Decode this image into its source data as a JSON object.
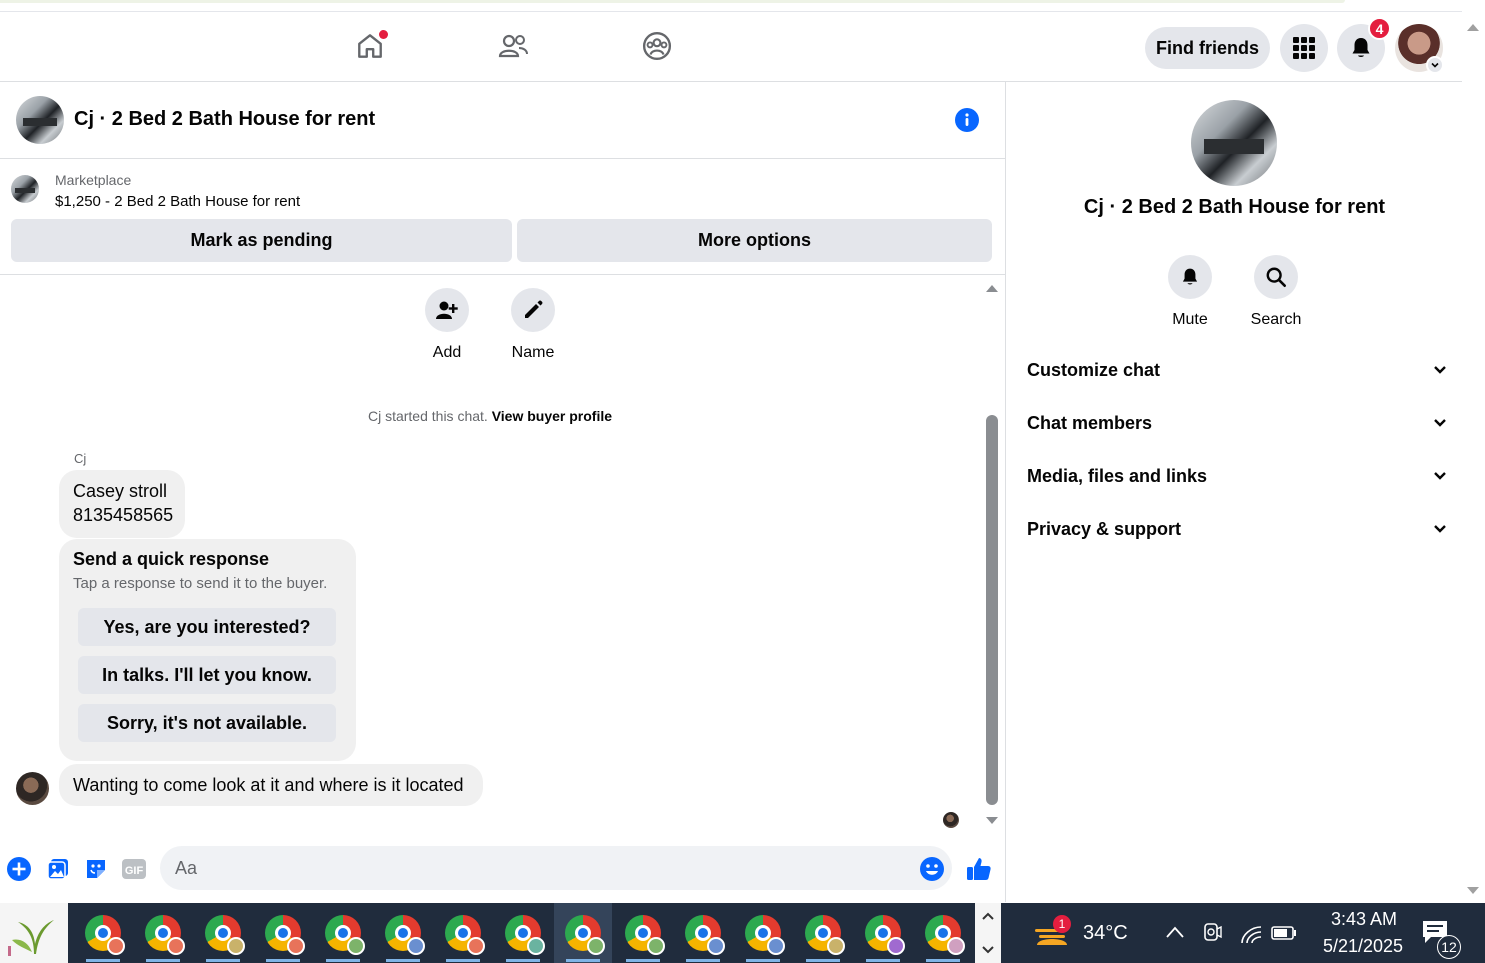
{
  "header": {
    "find_friends_label": "Find friends",
    "notification_count": "4"
  },
  "chat": {
    "title": "Cj · 2 Bed 2 Bath House for rent",
    "marketplace_label": "Marketplace",
    "listing": "$1,250 - 2 Bed 2 Bath House for rent",
    "mark_pending_label": "Mark as pending",
    "more_options_label": "More options",
    "actions": [
      {
        "label": "Add",
        "icon": "add-person-icon"
      },
      {
        "label": "Name",
        "icon": "pencil-icon"
      }
    ],
    "started_text": "Cj started this chat.",
    "buyer_profile_link": "View buyer profile",
    "sender_name": "Cj",
    "messages": [
      {
        "line1": "Casey stroll",
        "line2": "8135458565"
      }
    ],
    "quick_response": {
      "title": "Send a quick response",
      "subtitle": "Tap a response to send it to the buyer.",
      "options": [
        "Yes, are you interested?",
        "In talks. I'll let you know.",
        "Sorry, it's not available."
      ]
    },
    "last_message": "Wanting to come look at it and where is it located",
    "composer_placeholder": "Aa"
  },
  "side": {
    "name": "Cj · 2 Bed 2 Bath House for rent",
    "actions": [
      {
        "label": "Mute",
        "icon": "bell-icon"
      },
      {
        "label": "Search",
        "icon": "search-icon"
      }
    ],
    "sections": [
      "Customize chat",
      "Chat members",
      "Media, files and links",
      "Privacy & support"
    ]
  },
  "taskbar": {
    "weather_temp": "34°C",
    "weather_badge": "1",
    "time": "3:43 AM",
    "date": "5/21/2025",
    "notification_count": "12",
    "chrome_profile_colors": [
      "#e8735a",
      "#e8735a",
      "#c9b26a",
      "#e8735a",
      "#7db36a",
      "#6a8fd0",
      "#e8735a",
      "#6ab3a0",
      "#7db36a",
      "#7db36a",
      "#6a8fd0",
      "#6a8fd0",
      "#c9b26a",
      "#a06ad0",
      "#d0a0c0"
    ]
  },
  "colors": {
    "accent": "#0866ff",
    "badge": "#e41e3f",
    "button_bg": "#e4e6eb"
  }
}
